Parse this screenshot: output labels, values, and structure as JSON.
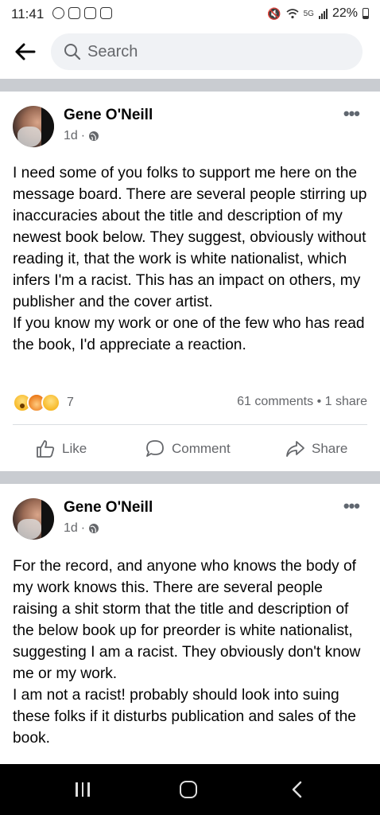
{
  "status_bar": {
    "time": "11:41",
    "network": "5G",
    "battery": "22%"
  },
  "search": {
    "placeholder": "Search"
  },
  "posts": [
    {
      "author": "Gene O'Neill",
      "time": "1d",
      "paragraphs": [
        "I need some of you folks to support me here on the message board. There are several people stirring up inaccuracies about the title and description of my newest book below. They suggest, obviously without reading it, that the work is white nationalist, which infers I'm a racist. This has an impact on others, my publisher and the cover artist.",
        "If you know my work or one of the few who has read the book, I'd appreciate a reaction."
      ],
      "reactions_count": "7",
      "comments": "61 comments",
      "shares": "1 share",
      "actions": {
        "like": "Like",
        "comment": "Comment",
        "share": "Share"
      }
    },
    {
      "author": "Gene O'Neill",
      "time": "1d",
      "paragraphs": [
        "For the record, and anyone who knows the body of my work knows this. There are several people raising a shit storm that the title and description of the below book up for preorder is white nationalist, suggesting I am a racist. They obviously don't know me or my work.",
        "I am not a racist! probably should look into suing these folks if it disturbs publication and sales of the book."
      ]
    }
  ],
  "icons": [
    "back-arrow-icon",
    "search-icon",
    "globe-icon",
    "more-icon",
    "like-icon",
    "comment-icon",
    "share-icon",
    "recents-icon",
    "home-icon",
    "nav-back-icon"
  ]
}
